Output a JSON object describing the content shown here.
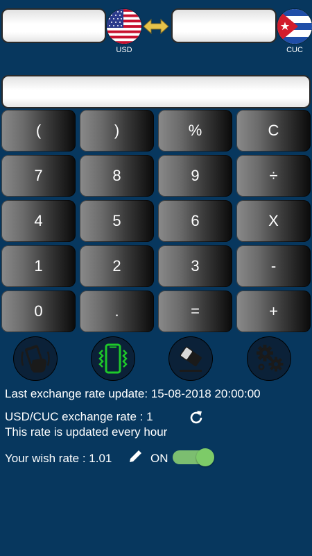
{
  "converter": {
    "from_value": "",
    "from_currency": "USD",
    "to_value": "",
    "to_currency": "CUC"
  },
  "expression": "",
  "keypad": [
    [
      "(",
      ")",
      "%",
      "C"
    ],
    [
      "7",
      "8",
      "9",
      "÷"
    ],
    [
      "4",
      "5",
      "6",
      "X"
    ],
    [
      "1",
      "2",
      "3",
      "-"
    ],
    [
      "0",
      ".",
      "=",
      "+"
    ]
  ],
  "tools": [
    "shake-phone-icon",
    "vibrate-phone-icon",
    "eraser-icon",
    "settings-gears-icon"
  ],
  "info": {
    "last_update": "Last exchange rate update: 15-08-2018 20:00:00",
    "rate_line": "USD/CUC exchange rate : 1",
    "update_note": "This rate is updated every hour",
    "wish_rate": "Your wish rate : 1.01",
    "toggle_label": "ON"
  },
  "toggle": {
    "state": "on"
  },
  "colors": {
    "background": "#07375e",
    "vibrate_accent": "#1ec92a",
    "toggle_on": "#7dcb68",
    "swap_arrow": "#e6c34a"
  }
}
